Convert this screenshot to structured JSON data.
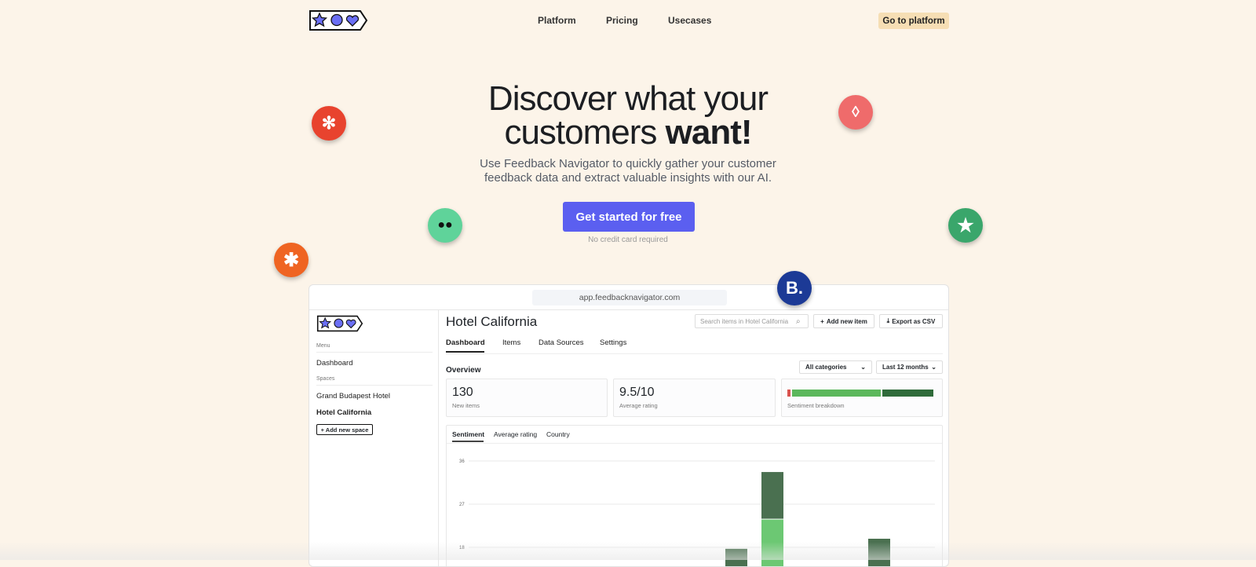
{
  "nav": {
    "items": [
      "Platform",
      "Pricing",
      "Usecases"
    ],
    "cta": "Go to platform"
  },
  "hero": {
    "title_line1": "Discover what your",
    "title_line2_regular": "customers",
    "title_line2_bold": "want!",
    "subtitle_line1": "Use Feedback Navigator to quickly gather your customer",
    "subtitle_line2": "feedback data and extract valuable insights with our AI.",
    "cta": "Get started for free",
    "note": "No credit card required"
  },
  "floating_badges": [
    "yelp-icon",
    "airbnb-icon",
    "tripadvisor-icon",
    "trustpilot-icon",
    "zendesk-icon",
    "booking-icon"
  ],
  "booking_letter": "B.",
  "colors": {
    "background": "#fcf4e9",
    "accent": "#5b5ff0",
    "logo_fill": "#6b6ff5",
    "positive": "#5cb85c",
    "very_positive": "#2f6b3a",
    "negative": "#d9534f"
  },
  "app": {
    "url": "app.feedbacknavigator.com",
    "sidebar": {
      "menu_label": "Menu",
      "dashboard": "Dashboard",
      "spaces_label": "Spaces",
      "spaces": [
        "Grand Budapest Hotel",
        "Hotel California"
      ],
      "active_space": "Hotel California",
      "add_space": "+ Add new space"
    },
    "title": "Hotel California",
    "search_placeholder": "Search items in Hotel California",
    "add_item": "Add new item",
    "export": "Export as CSV",
    "tabs": [
      "Dashboard",
      "Items",
      "Data Sources",
      "Settings"
    ],
    "active_tab": "Dashboard",
    "overview": "Overview",
    "filters": {
      "category": "All categories",
      "period": "Last 12 months"
    },
    "stats": [
      {
        "value": "130",
        "label": "New items"
      },
      {
        "value": "9.5/10",
        "label": "Average rating"
      }
    ],
    "sentiment": {
      "label": "Sentiment breakdown",
      "negative": 0.02,
      "positive": 0.6,
      "very_positive": 0.35
    },
    "chart_tabs": [
      "Sentiment",
      "Average rating",
      "Country"
    ],
    "active_chart_tab": "Sentiment"
  },
  "chart_data": {
    "type": "bar",
    "stacked": true,
    "yticks": [
      18,
      27,
      36
    ],
    "ylim_visible": [
      18,
      36
    ],
    "grid": true,
    "bars": [
      {
        "segments": [
          {
            "color": "#4a7050",
            "top": 17.7
          }
        ]
      },
      {
        "segments": [
          {
            "color": "#6cc873",
            "top": 23.8
          },
          {
            "color": "#4a7050",
            "top": 33.7
          }
        ]
      },
      {
        "segments": [
          {
            "color": "#4a7050",
            "top": 19.8
          }
        ]
      }
    ]
  }
}
